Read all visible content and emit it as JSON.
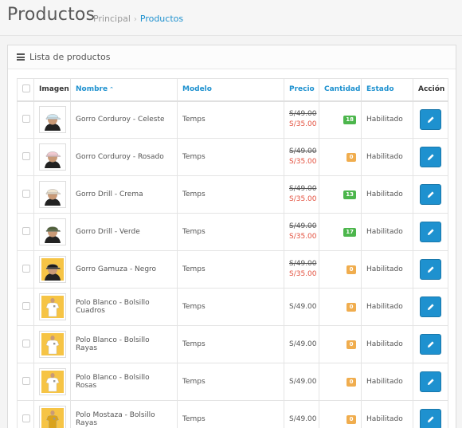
{
  "header": {
    "title": "Productos",
    "breadcrumb": [
      {
        "label": "Principal"
      },
      {
        "label": "Productos"
      }
    ],
    "breadcrumb_sep": "›"
  },
  "panel": {
    "title": "Lista de productos",
    "icon": "list-icon"
  },
  "table": {
    "columns": {
      "image": "Imagen",
      "name": "Nombre",
      "name_sort": "⌃",
      "model": "Modelo",
      "price": "Precio",
      "quantity": "Cantidad",
      "status": "Estado",
      "action": "Acción"
    },
    "rows": [
      {
        "name": "Gorro Corduroy - Celeste",
        "model": "Temps",
        "price": "S/49.00",
        "special": "S/35.00",
        "quantity": "18",
        "status": "Habilitado",
        "qty_state": "ok",
        "img": "cap-light-blue"
      },
      {
        "name": "Gorro Corduroy - Rosado",
        "model": "Temps",
        "price": "S/49.00",
        "special": "S/35.00",
        "quantity": "0",
        "status": "Habilitado",
        "qty_state": "warn",
        "img": "cap-pink"
      },
      {
        "name": "Gorro Drill - Crema",
        "model": "Temps",
        "price": "S/49.00",
        "special": "S/35.00",
        "quantity": "13",
        "status": "Habilitado",
        "qty_state": "ok",
        "img": "cap-cream"
      },
      {
        "name": "Gorro Drill - Verde",
        "model": "Temps",
        "price": "S/49.00",
        "special": "S/35.00",
        "quantity": "17",
        "status": "Habilitado",
        "qty_state": "ok",
        "img": "cap-green"
      },
      {
        "name": "Gorro Gamuza - Negro",
        "model": "Temps",
        "price": "S/49.00",
        "special": "S/35.00",
        "quantity": "0",
        "status": "Habilitado",
        "qty_state": "warn",
        "img": "cap-black"
      },
      {
        "name": "Polo Blanco - Bolsillo Cuadros",
        "model": "Temps",
        "price": "S/49.00",
        "special": null,
        "quantity": "0",
        "status": "Habilitado",
        "qty_state": "warn",
        "img": "shirt-white"
      },
      {
        "name": "Polo Blanco - Bolsillo Rayas",
        "model": "Temps",
        "price": "S/49.00",
        "special": null,
        "quantity": "0",
        "status": "Habilitado",
        "qty_state": "warn",
        "img": "shirt-white"
      },
      {
        "name": "Polo Blanco - Bolsillo Rosas",
        "model": "Temps",
        "price": "S/49.00",
        "special": null,
        "quantity": "0",
        "status": "Habilitado",
        "qty_state": "warn",
        "img": "shirt-white"
      },
      {
        "name": "Polo Mostaza - Bolsillo Rayas",
        "model": "Temps",
        "price": "S/49.00",
        "special": null,
        "quantity": "0",
        "status": "Habilitado",
        "qty_state": "warn",
        "img": "shirt-mustard"
      }
    ],
    "edit_icon": "pencil-icon"
  },
  "colors": {
    "accent": "#1e91cf",
    "sale": "#e3503e",
    "badge_ok": "#4cb64c",
    "badge_warn": "#f0ad4e",
    "cap_light_blue": "#cfe6f0",
    "cap_pink": "#f2c9d0",
    "cap_cream": "#efe4cf",
    "cap_green": "#4f5f3a",
    "cap_black": "#1c1c1c",
    "shirt_bg": "#f6c445",
    "shirt_white": "#ffffff",
    "shirt_mustard": "#d9a21c"
  }
}
